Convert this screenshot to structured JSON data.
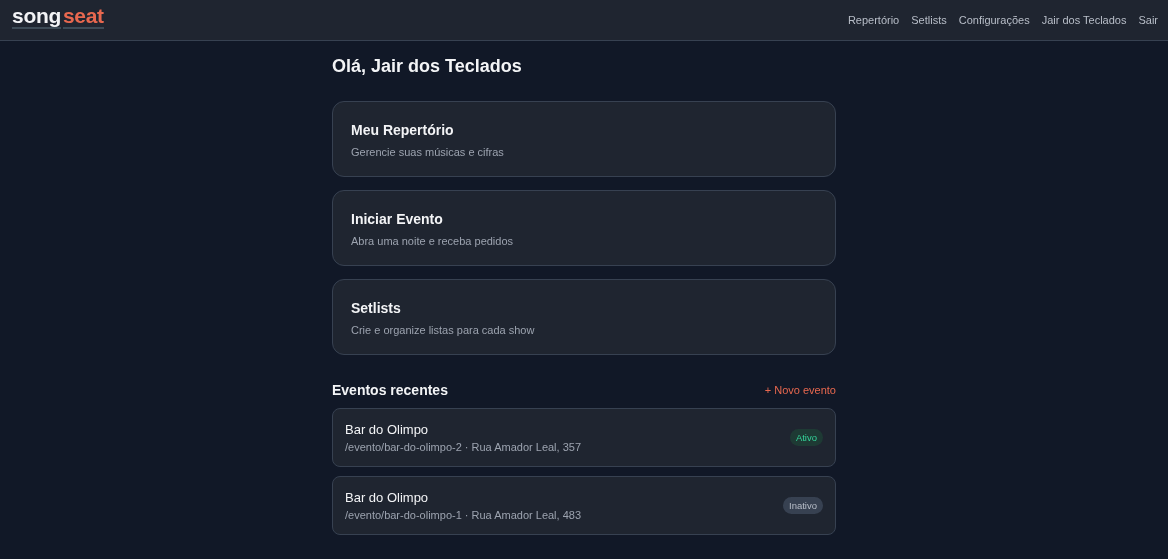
{
  "logo": {
    "parts": [
      "song",
      "seat"
    ]
  },
  "nav": [
    "Repertório",
    "Setlists",
    "Configurações",
    "Jair dos Teclados",
    "Sair"
  ],
  "greeting": "Olá, Jair dos Teclados",
  "cards": [
    {
      "title": "Meu Repertório",
      "subtitle": "Gerencie suas músicas e cifras"
    },
    {
      "title": "Iniciar Evento",
      "subtitle": "Abra uma noite e receba pedidos"
    },
    {
      "title": "Setlists",
      "subtitle": "Crie e organize listas para cada show"
    }
  ],
  "recent": {
    "title": "Eventos recentes",
    "new_link": "+ Novo evento",
    "events": [
      {
        "name": "Bar do Olimpo",
        "details": "/evento/bar-do-olimpo-2 · Rua Amador Leal, 357",
        "status": "Ativo",
        "active": true
      },
      {
        "name": "Bar do Olimpo",
        "details": "/evento/bar-do-olimpo-1 · Rua Amador Leal, 483",
        "status": "Inativo",
        "active": false
      }
    ]
  }
}
